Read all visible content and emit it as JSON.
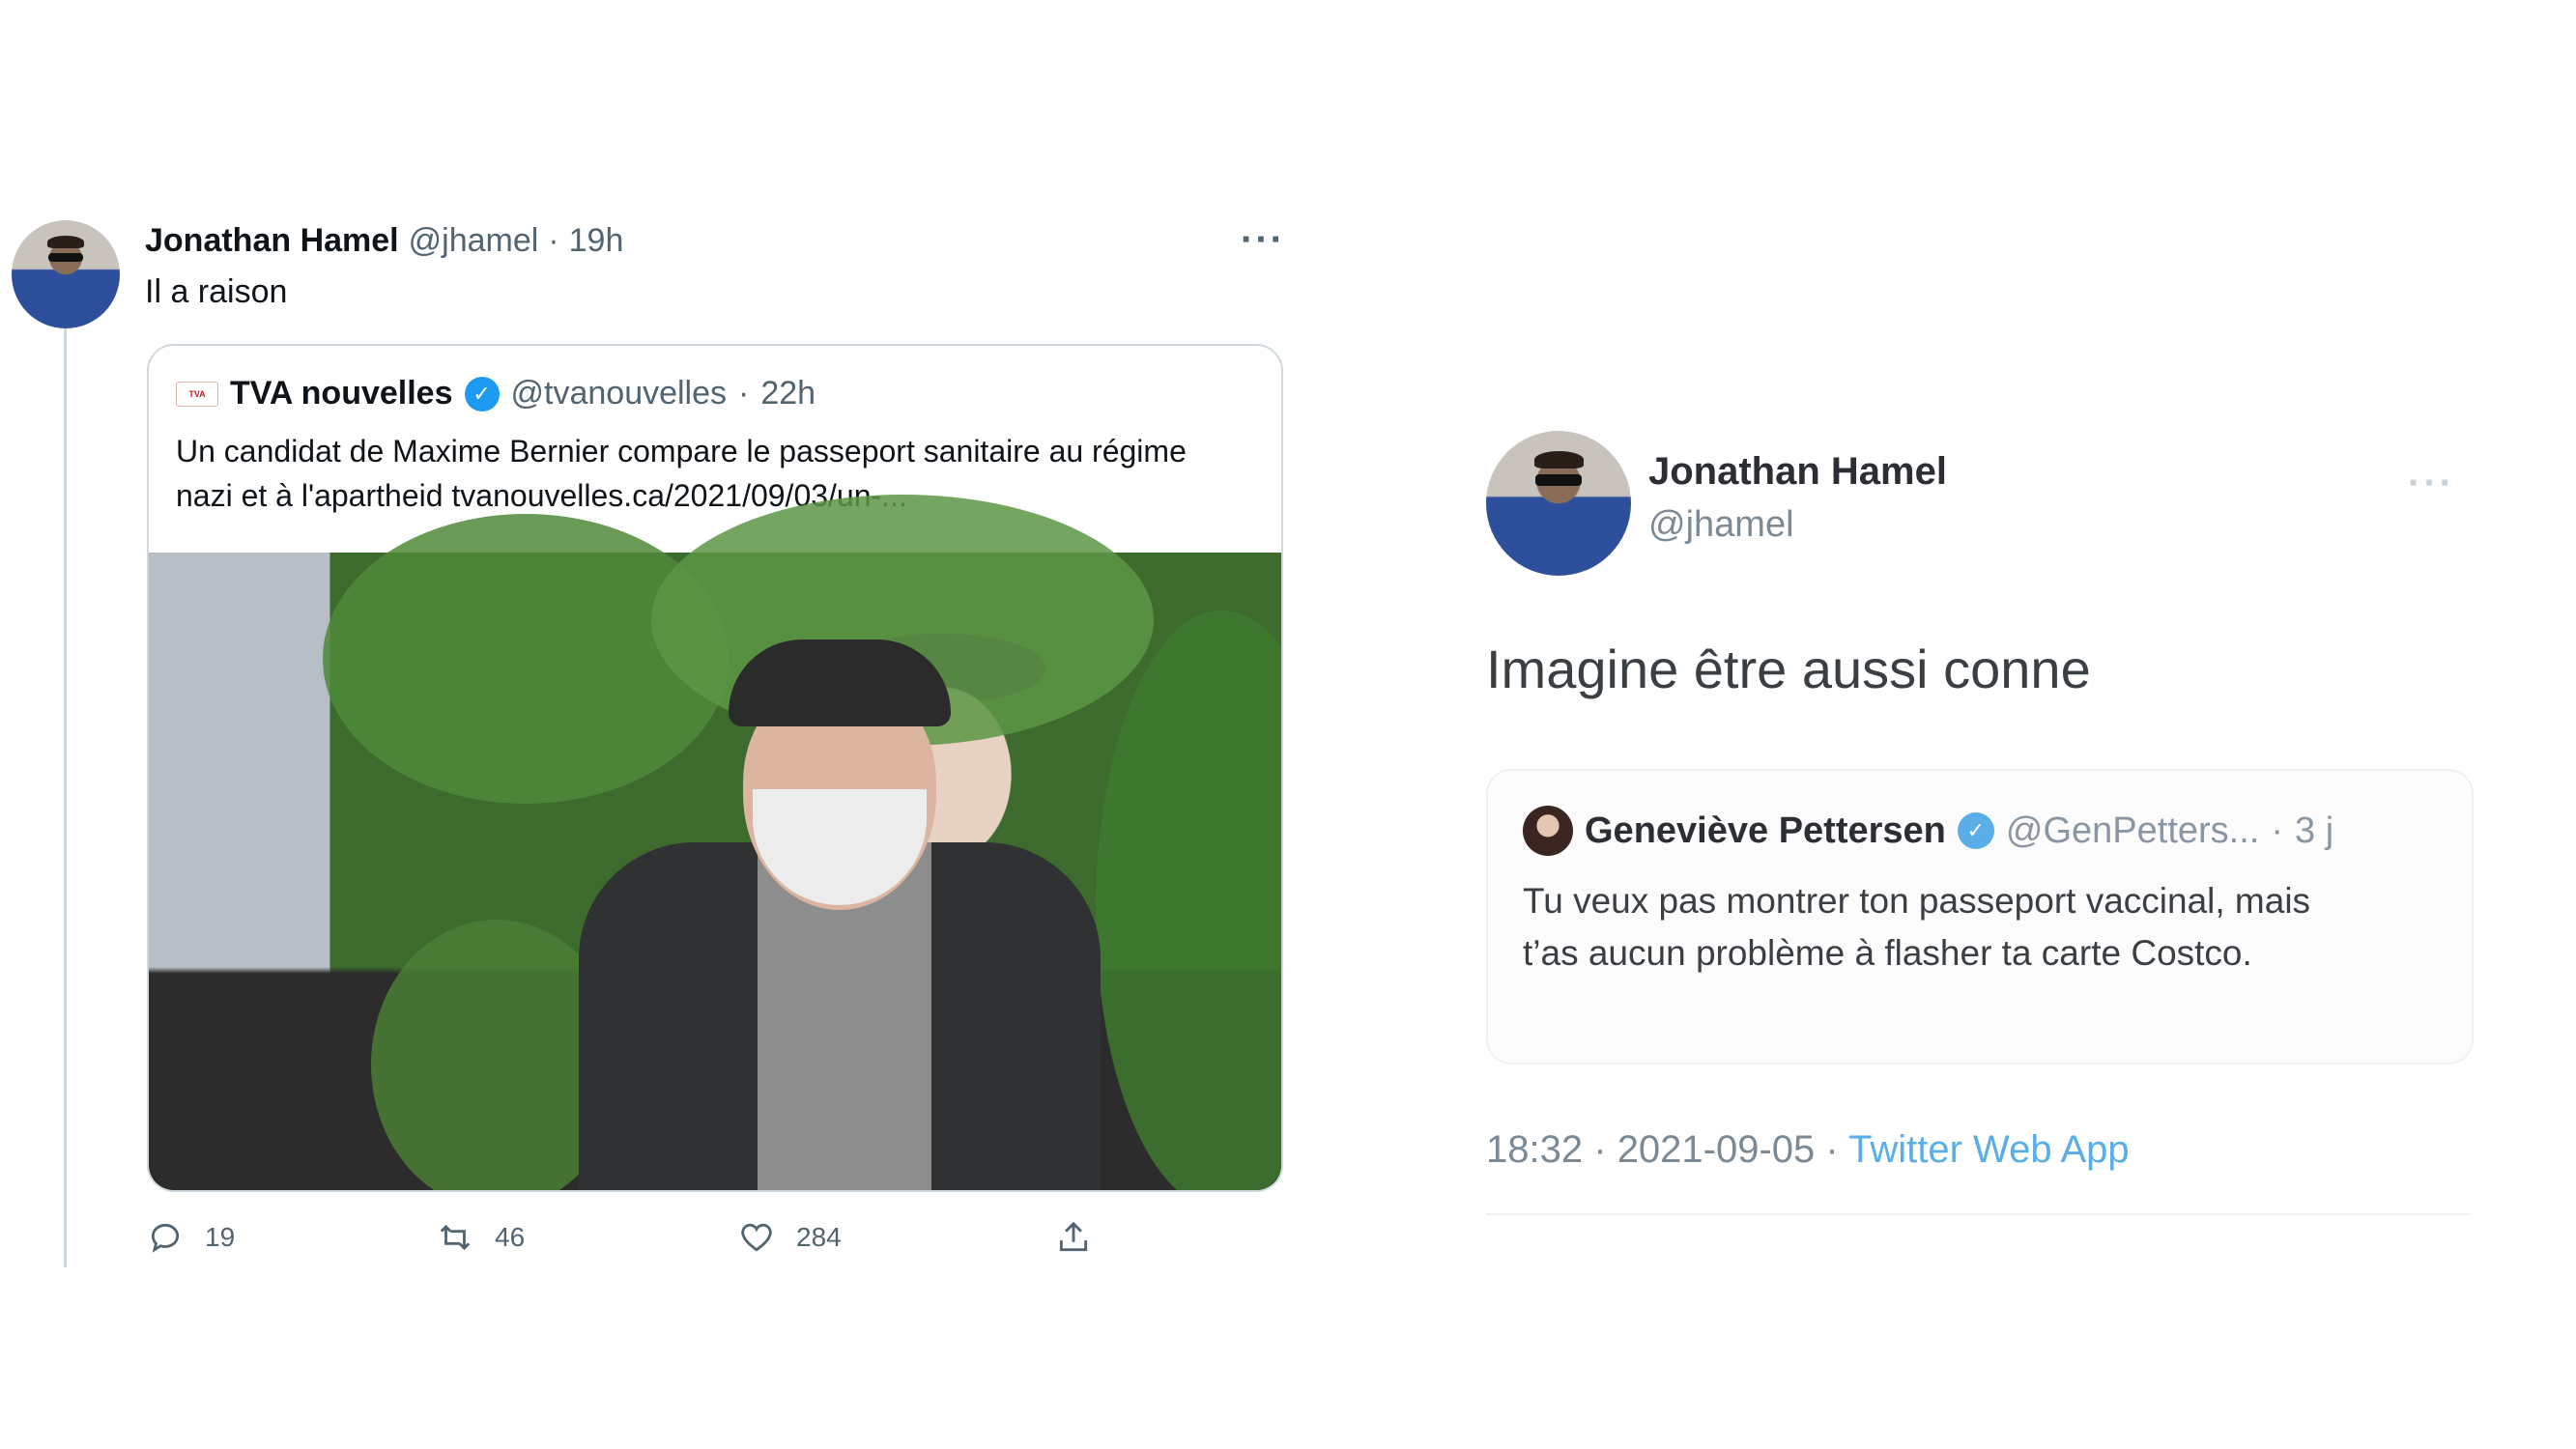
{
  "left_tweet": {
    "author": {
      "name": "Jonathan Hamel",
      "handle": "@jhamel",
      "time": "19h"
    },
    "separator": "·",
    "more_label": "···",
    "text": "Il a raison",
    "quoted": {
      "logo_text": "TVA",
      "author": {
        "name": "TVA nouvelles",
        "handle": "@tvanouvelles",
        "time": "22h"
      },
      "text": "Un candidat de Maxime Bernier compare le passeport sanitaire au régime nazi et à l'apartheid tvanouvelles.ca/2021/09/03/un-..."
    },
    "actions": {
      "replies": "19",
      "retweets": "46",
      "likes": "284"
    }
  },
  "right_tweet": {
    "author": {
      "name": "Jonathan Hamel",
      "handle": "@jhamel"
    },
    "more_label": "···",
    "text": "Imagine être aussi conne",
    "quoted": {
      "author": {
        "name": "Geneviève Pettersen",
        "handle": "@GenPetters...",
        "time": "3 j"
      },
      "separator": "·",
      "text": "Tu veux pas montrer ton passeport vaccinal, mais t’as aucun problème à flasher ta carte Costco."
    },
    "meta": {
      "time": "18:32",
      "date": "2021-09-05",
      "separator": "·",
      "source": "Twitter Web App"
    }
  },
  "colors": {
    "link": "#1d9bf0",
    "verified": "#1d9bf0",
    "muted_text": "#536471"
  }
}
